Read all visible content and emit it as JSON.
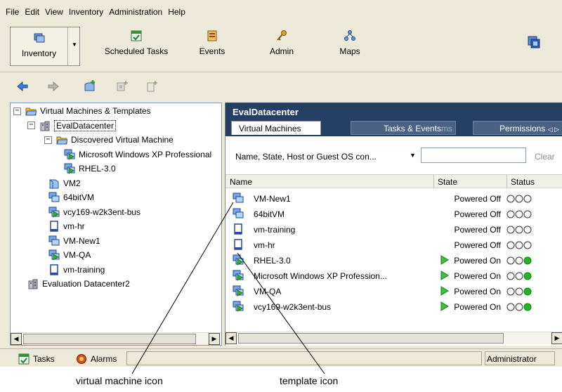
{
  "menu": [
    "File",
    "Edit",
    "View",
    "Inventory",
    "Administration",
    "Help"
  ],
  "toolbar": {
    "inventory": "Inventory",
    "scheduled_tasks": "Scheduled Tasks",
    "events": "Events",
    "admin": "Admin",
    "maps": "Maps"
  },
  "tree": {
    "items": [
      {
        "label": "Virtual Machines & Templates",
        "icon": "folder-open-icon",
        "toggle": "−"
      },
      {
        "label": "EvalDatacenter",
        "icon": "datacenter-icon",
        "toggle": "−"
      },
      {
        "label": "Discovered Virtual Machine",
        "icon": "folder-open-icon",
        "toggle": "−"
      },
      {
        "label": "Microsoft Windows XP Professional",
        "icon": "vm-on-icon",
        "toggle": ""
      },
      {
        "label": "RHEL-3.0",
        "icon": "vm-on-icon",
        "toggle": ""
      },
      {
        "label": "VM2",
        "icon": "folder-icon",
        "toggle": ""
      },
      {
        "label": "64bitVM",
        "icon": "vm-icon",
        "toggle": ""
      },
      {
        "label": "vcy169-w2k3ent-bus",
        "icon": "vm-on-icon",
        "toggle": ""
      },
      {
        "label": "vm-hr",
        "icon": "template-icon",
        "toggle": ""
      },
      {
        "label": "VM-New1",
        "icon": "vm-icon",
        "toggle": ""
      },
      {
        "label": "VM-QA",
        "icon": "vm-on-icon",
        "toggle": ""
      },
      {
        "label": "vm-training",
        "icon": "template-icon",
        "toggle": ""
      },
      {
        "label": "Evaluation Datacenter2",
        "icon": "datacenter-icon",
        "toggle": ""
      }
    ]
  },
  "right_panel": {
    "title": "EvalDatacenter",
    "tabs": [
      "Virtual Machines",
      "Tasks & Events",
      "ms",
      "Permissions",
      "◁ ▷"
    ],
    "filter_label": "Name, State, Host or Guest OS con...",
    "filter_value": "",
    "clear": "Clear",
    "columns": [
      "Name",
      "State",
      "Status"
    ],
    "rows": [
      {
        "name": "VM-New1",
        "state": "Powered Off",
        "icon": "vm-icon",
        "on": false
      },
      {
        "name": "64bitVM",
        "state": "Powered Off",
        "icon": "vm-icon",
        "on": false
      },
      {
        "name": "vm-training",
        "state": "Powered Off",
        "icon": "template-icon",
        "on": false
      },
      {
        "name": "vm-hr",
        "state": "Powered Off",
        "icon": "template-icon",
        "on": false
      },
      {
        "name": "RHEL-3.0",
        "state": "Powered On",
        "icon": "vm-on-icon",
        "on": true
      },
      {
        "name": "Microsoft Windows XP Profession...",
        "state": "Powered On",
        "icon": "vm-on-icon",
        "on": true
      },
      {
        "name": "VM-QA",
        "state": "Powered On",
        "icon": "vm-on-icon",
        "on": true
      },
      {
        "name": "vcy169-w2k3ent-bus",
        "state": "Powered On",
        "icon": "vm-on-icon",
        "on": true
      }
    ]
  },
  "statusbar": {
    "tasks": "Tasks",
    "alarms": "Alarms",
    "user": "Administrator"
  },
  "captions": {
    "vm_icon": "virtual machine icon",
    "template_icon": "template icon"
  },
  "colors": {
    "header_bg": "#243f63",
    "powered_on_green": "#22b422",
    "toolbar_bg": "#ece9d8"
  }
}
